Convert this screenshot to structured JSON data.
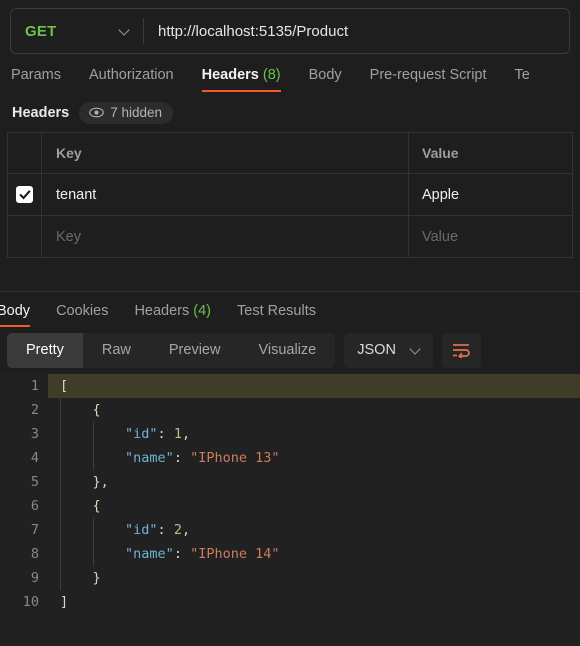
{
  "request": {
    "method": "GET",
    "url": "http://localhost:5135/Product",
    "tabs": [
      {
        "label": "Params",
        "count": "",
        "active": false
      },
      {
        "label": "Authorization",
        "count": "",
        "active": false
      },
      {
        "label": "Headers",
        "count": "(8)",
        "active": true
      },
      {
        "label": "Body",
        "count": "",
        "active": false
      },
      {
        "label": "Pre-request Script",
        "count": "",
        "active": false
      },
      {
        "label": "Te",
        "count": "",
        "active": false
      }
    ]
  },
  "headers_panel": {
    "title": "Headers",
    "hidden_badge": "7 hidden",
    "columns": {
      "key": "Key",
      "value": "Value"
    },
    "rows": [
      {
        "checked": true,
        "key": "tenant",
        "value": "Apple",
        "placeholder": false
      },
      {
        "checked": false,
        "key": "Key",
        "value": "Value",
        "placeholder": true
      }
    ]
  },
  "response": {
    "tabs": [
      {
        "label": "Body",
        "count": "",
        "active": true
      },
      {
        "label": "Cookies",
        "count": "",
        "active": false
      },
      {
        "label": "Headers",
        "count": "(4)",
        "active": false
      },
      {
        "label": "Test Results",
        "count": "",
        "active": false
      }
    ],
    "view_modes": [
      {
        "label": "Pretty",
        "active": true
      },
      {
        "label": "Raw",
        "active": false
      },
      {
        "label": "Preview",
        "active": false
      },
      {
        "label": "Visualize",
        "active": false
      }
    ],
    "format": "JSON",
    "body_lines": [
      {
        "n": "1",
        "highlight": true,
        "tokens": [
          {
            "t": "[",
            "c": "tk-punct"
          }
        ]
      },
      {
        "n": "2",
        "highlight": false,
        "tokens": [
          {
            "t": "    {",
            "c": "tk-punct"
          }
        ]
      },
      {
        "n": "3",
        "highlight": false,
        "tokens": [
          {
            "t": "        ",
            "c": "tk-punct"
          },
          {
            "t": "\"id\"",
            "c": "tk-key"
          },
          {
            "t": ": ",
            "c": "tk-colon"
          },
          {
            "t": "1",
            "c": "tk-num"
          },
          {
            "t": ",",
            "c": "tk-punct"
          }
        ]
      },
      {
        "n": "4",
        "highlight": false,
        "tokens": [
          {
            "t": "        ",
            "c": "tk-punct"
          },
          {
            "t": "\"name\"",
            "c": "tk-key"
          },
          {
            "t": ": ",
            "c": "tk-colon"
          },
          {
            "t": "\"IPhone 13\"",
            "c": "tk-str"
          }
        ]
      },
      {
        "n": "5",
        "highlight": false,
        "tokens": [
          {
            "t": "    },",
            "c": "tk-punct"
          }
        ]
      },
      {
        "n": "6",
        "highlight": false,
        "tokens": [
          {
            "t": "    {",
            "c": "tk-punct"
          }
        ]
      },
      {
        "n": "7",
        "highlight": false,
        "tokens": [
          {
            "t": "        ",
            "c": "tk-punct"
          },
          {
            "t": "\"id\"",
            "c": "tk-key"
          },
          {
            "t": ": ",
            "c": "tk-colon"
          },
          {
            "t": "2",
            "c": "tk-num"
          },
          {
            "t": ",",
            "c": "tk-punct"
          }
        ]
      },
      {
        "n": "8",
        "highlight": false,
        "tokens": [
          {
            "t": "        ",
            "c": "tk-punct"
          },
          {
            "t": "\"name\"",
            "c": "tk-key"
          },
          {
            "t": ": ",
            "c": "tk-colon"
          },
          {
            "t": "\"IPhone 14\"",
            "c": "tk-str"
          }
        ]
      },
      {
        "n": "9",
        "highlight": false,
        "tokens": [
          {
            "t": "    }",
            "c": "tk-punct"
          }
        ]
      },
      {
        "n": "10",
        "highlight": false,
        "tokens": [
          {
            "t": "]",
            "c": "tk-punct"
          }
        ]
      }
    ]
  },
  "colors": {
    "accent_orange": "#ef5b25",
    "method_green": "#6cc24a",
    "page_bg": "#1e1e1e",
    "editor_bg": "#212121",
    "line_highlight": "#3f3d28"
  },
  "icons": {
    "method_chevron": "chevron-down-icon",
    "eye": "eye-icon",
    "format_chevron": "chevron-down-icon",
    "wrap": "wrap-text-icon",
    "check": "check-icon"
  }
}
